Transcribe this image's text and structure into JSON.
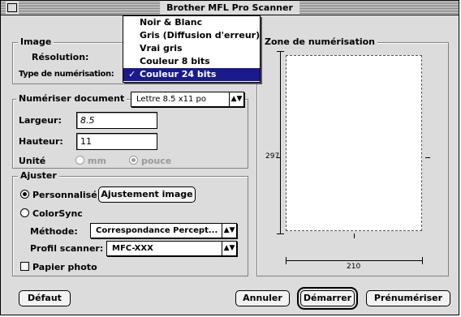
{
  "window": {
    "title": "Brother MFL Pro Scanner"
  },
  "image_group": {
    "label": "Image",
    "resolution_label": "Résolution:",
    "scan_type_label": "Type de numérisation:"
  },
  "scan_type_menu": {
    "items": [
      {
        "label": "Noir & Blanc",
        "checked": false
      },
      {
        "label": "Gris (Diffusion d'erreur)",
        "checked": false
      },
      {
        "label": "Vrai gris",
        "checked": false
      },
      {
        "label": "Couleur 8 bits",
        "checked": false
      },
      {
        "label": "Couleur 24 bits",
        "checked": true
      }
    ],
    "check_mark": "✓"
  },
  "scan_doc_group": {
    "label": "Numériser document",
    "size_value": "Lettre 8.5 x11 po",
    "width_label": "Largeur:",
    "width_value": "8.5",
    "height_label": "Hauteur:",
    "height_value": "11",
    "unit_label": "Unité",
    "unit_mm": "mm",
    "unit_inch": "pouce",
    "selected_unit": "pouce"
  },
  "adjust_group": {
    "label": "Ajuster",
    "custom_label": "Personnalisé",
    "adjust_image_button": "Ajustement image",
    "colorsync_label": "ColorSync",
    "method_label": "Méthode:",
    "method_value": "Correspondance Percept...",
    "profile_label": "Profil scanner:",
    "profile_value": "MFC-XXX",
    "photo_paper_label": "Papier photo",
    "selected_mode": "Personnalisé",
    "photo_paper_checked": false
  },
  "scan_area": {
    "label": "Zone de numérisation",
    "height_mark": "297",
    "width_mark": "210"
  },
  "buttons": {
    "default": "Défaut",
    "cancel": "Annuler",
    "start": "Démarrer",
    "prescan": "Prénumériser"
  }
}
